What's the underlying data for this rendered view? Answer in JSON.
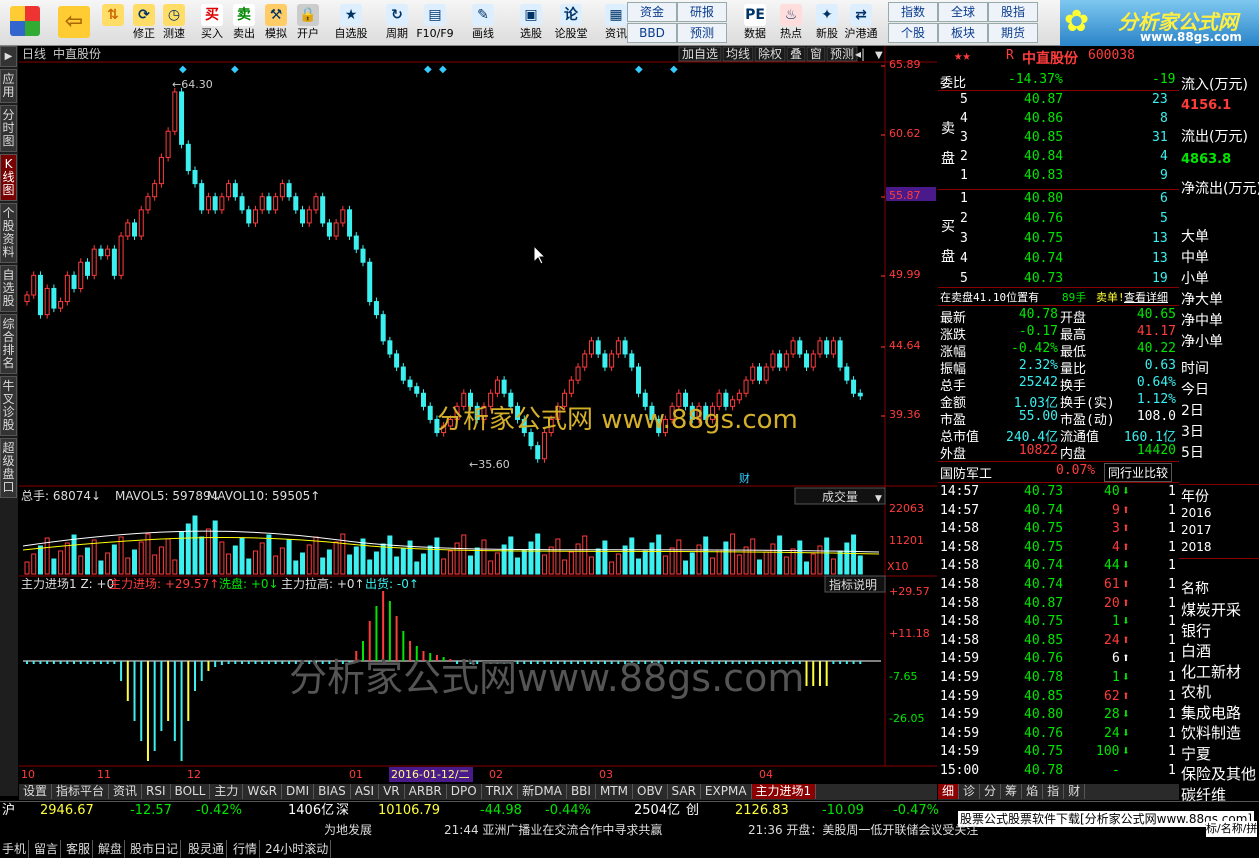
{
  "toolbar": {
    "buttons": [
      {
        "label": "修正",
        "icon": "up-arrow-icon"
      },
      {
        "label": "测速",
        "icon": "clock-icon"
      },
      {
        "label": "买入",
        "icon": "buy-icon",
        "ic": "买"
      },
      {
        "label": "卖出",
        "icon": "sell-icon",
        "ic": "卖"
      },
      {
        "label": "模拟",
        "icon": "hammer-icon"
      },
      {
        "label": "开户",
        "icon": "lock-icon"
      },
      {
        "label": "自选股",
        "icon": "star-folder-icon"
      },
      {
        "label": "周期",
        "icon": "cycle-icon"
      },
      {
        "label": "F10/F9",
        "icon": "f10-icon"
      },
      {
        "label": "画线",
        "icon": "pen-icon"
      },
      {
        "label": "选股",
        "icon": "monitor-icon"
      },
      {
        "label": "论股堂",
        "icon": "forum-icon"
      },
      {
        "label": "资讯",
        "icon": "news-icon"
      },
      {
        "label": "数据",
        "icon": "pe-icon",
        "ic": "PE"
      },
      {
        "label": "热点",
        "icon": "hot-icon"
      },
      {
        "label": "新股",
        "icon": "new-stock-icon"
      },
      {
        "label": "沪港通",
        "icon": "sse-hke-icon"
      }
    ],
    "small": [
      [
        "资金",
        "研报"
      ],
      [
        "BBD",
        "预测"
      ],
      [
        "指数",
        "全球",
        "股指"
      ],
      [
        "个股",
        "板块",
        "期货"
      ]
    ]
  },
  "logo": {
    "title": "分析家公式网",
    "url": "www.88gs.com"
  },
  "left_tabs": [
    "应用",
    "分时图",
    "K线图",
    "个股资料",
    "自选股",
    "综合排名",
    "牛叉诊股",
    "超级盘口"
  ],
  "chart_header": {
    "period": "日线",
    "name": "中直股份",
    "buttons": [
      "加自选",
      "均线",
      "除权",
      "叠",
      "窗",
      "预测"
    ]
  },
  "price_axis": [
    "65.89",
    "60.62",
    "55.87",
    "49.99",
    "44.64",
    "39.36"
  ],
  "price_axis_hl": "55.87",
  "annot": {
    "high": "64.30",
    "low": "35.60",
    "cai": "财"
  },
  "watermark": "分析家公式网 www.88gs.com",
  "watermark2": "分析家公式网www.88gs.com",
  "vol": {
    "title": "总手: 68074",
    "ma5": "MAVOL5: 59789",
    "ma10": "MAVOL10: 59505",
    "label": "成交量",
    "axis": [
      "22063",
      "11201"
    ],
    "x10": "X10"
  },
  "ind": {
    "t1": "主力进场1 Z: +0",
    "t2": "主力进场: +29.57",
    "t3": "洗盘: +0",
    "t4": "主力拉高: +0",
    "t5": "出货: -0",
    "btn": "指标说明",
    "axis": [
      "+29.57",
      "+11.18",
      "-7.65",
      "-26.05"
    ]
  },
  "xaxis": [
    "10",
    "11",
    "12",
    "01",
    "02",
    "03",
    "04"
  ],
  "xsel": "2016-01-12/二",
  "chart_data": {
    "type": "candlestick",
    "ylim": [
      35.6,
      64.3
    ],
    "high": 64.3,
    "low": 35.6,
    "note": "daily K-line with volume and 主力进场 indicator",
    "indicator": {
      "主力进场": 29.57,
      "洗盘": 0,
      "主力拉高": 0,
      "出货": 0
    },
    "volume": {
      "总手": 68074,
      "MAVOL5": 59789,
      "MAVOL10": 59505
    }
  },
  "quote": {
    "stars": "★★",
    "code_r": "R",
    "name": "中直股份",
    "code": "600038",
    "weibi_label": "委比",
    "weibi": "-14.37%",
    "weicha": "-19",
    "sell_label": "卖盘",
    "buy_label": "买盘",
    "sells": [
      [
        "5",
        "40.87",
        "23"
      ],
      [
        "4",
        "40.86",
        "8"
      ],
      [
        "3",
        "40.85",
        "31"
      ],
      [
        "2",
        "40.84",
        "4"
      ],
      [
        "1",
        "40.83",
        "9"
      ]
    ],
    "buys": [
      [
        "1",
        "40.80",
        "6"
      ],
      [
        "2",
        "40.76",
        "5"
      ],
      [
        "3",
        "40.75",
        "13"
      ],
      [
        "4",
        "40.74",
        "13"
      ],
      [
        "5",
        "40.73",
        "19"
      ]
    ],
    "notice": "在卖盘41.10位置有",
    "notice_qty": "89手",
    "notice_act": "卖单!",
    "notice_link": "查看详细",
    "stats": [
      [
        "最新",
        "40.78",
        "开盘",
        "40.65"
      ],
      [
        "涨跌",
        "-0.17",
        "最高",
        "41.17"
      ],
      [
        "涨幅",
        "-0.42%",
        "最低",
        "40.22"
      ],
      [
        "振幅",
        "2.32%",
        "量比",
        "0.63"
      ],
      [
        "总手",
        "25242",
        "换手",
        "0.64%"
      ],
      [
        "金额",
        "1.03亿",
        "换手(实)",
        "1.12%"
      ],
      [
        "市盈",
        "55.00",
        "市盈(动)",
        "108.0"
      ],
      [
        "总市值",
        "240.4亿",
        "流通值",
        "160.1亿"
      ],
      [
        "外盘",
        "10822",
        "内盘",
        "14420"
      ]
    ],
    "sector": "国防军工",
    "sector_pct": "0.07%",
    "sector_btn": "同行业比较"
  },
  "ticks": [
    [
      "14:57",
      "40.73",
      "40",
      "down"
    ],
    [
      "14:57",
      "40.74",
      "9",
      "up"
    ],
    [
      "14:58",
      "40.75",
      "3",
      "up"
    ],
    [
      "14:58",
      "40.75",
      "4",
      "up"
    ],
    [
      "14:58",
      "40.74",
      "44",
      "down"
    ],
    [
      "14:58",
      "40.74",
      "61",
      "up"
    ],
    [
      "14:58",
      "40.87",
      "20",
      "up"
    ],
    [
      "14:58",
      "40.75",
      "1",
      "down"
    ],
    [
      "14:58",
      "40.85",
      "24",
      "up"
    ],
    [
      "14:59",
      "40.76",
      "6",
      "white-up"
    ],
    [
      "14:59",
      "40.78",
      "1",
      "down"
    ],
    [
      "14:59",
      "40.85",
      "62",
      "up"
    ],
    [
      "14:59",
      "40.80",
      "28",
      "down"
    ],
    [
      "14:59",
      "40.76",
      "24",
      "down"
    ],
    [
      "14:59",
      "40.75",
      "100",
      "down"
    ],
    [
      "15:00",
      "40.78",
      "-",
      "none"
    ]
  ],
  "rp_tabs": [
    "细",
    "诊",
    "分",
    "筹",
    "焰",
    "指",
    "财"
  ],
  "far": {
    "flow": [
      [
        "流入(万元)",
        "4156.1",
        "red"
      ],
      [
        "流出(万元)",
        "4863.8",
        "grn"
      ],
      [
        "净流出(万元)",
        "",
        ""
      ]
    ],
    "order_labels": [
      "大单",
      "中单",
      "小单",
      "净大单",
      "净中单",
      "净小单",
      "时间",
      "今日",
      "2日",
      "3日",
      "5日"
    ],
    "year_label": "年份",
    "years": [
      "2016",
      "2017",
      "2018"
    ],
    "name_label": "名称",
    "sectors": [
      "煤炭开采",
      "银行",
      "白酒",
      "化工新材",
      "农机",
      "集成电路",
      "饮料制造",
      "宁夏",
      "保险及其他",
      "碳纤维"
    ]
  },
  "bottom_tabs": [
    "设置",
    "指标平台",
    "资讯",
    "RSI",
    "BOLL",
    "主力",
    "W&R",
    "DMI",
    "BIAS",
    "ASI",
    "VR",
    "ARBR",
    "DPO",
    "TRIX",
    "新DMA",
    "BBI",
    "MTM",
    "OBV",
    "SAR",
    "EXPMA",
    "主力进场1"
  ],
  "status": {
    "sh": {
      "label": "沪",
      "idx": "2946.67",
      "chg": "-12.57",
      "pct": "-0.42%",
      "amt": "1406亿"
    },
    "sz": {
      "label": "深",
      "idx": "10106.79",
      "chg": "-44.98",
      "pct": "-0.44%",
      "amt": "2504亿"
    },
    "cy": {
      "label": "创",
      "idx": "2126.83",
      "chg": "-10.09",
      "pct": "-0.47%"
    },
    "ad": "股票公式股票软件下载[分析家公式网www.88gs.com]",
    "links": [
      "手机",
      "留言",
      "客服",
      "解盘",
      "股市日记",
      "股灵通",
      "行情",
      "24小时滚动"
    ],
    "news1": "为地发展",
    "news2": "21:44 亚洲广播业在交流合作中寻求共赢",
    "news3": "21:36 开盘：美股周一低开联储会议受关注",
    "tail": "标/名称/拼"
  }
}
